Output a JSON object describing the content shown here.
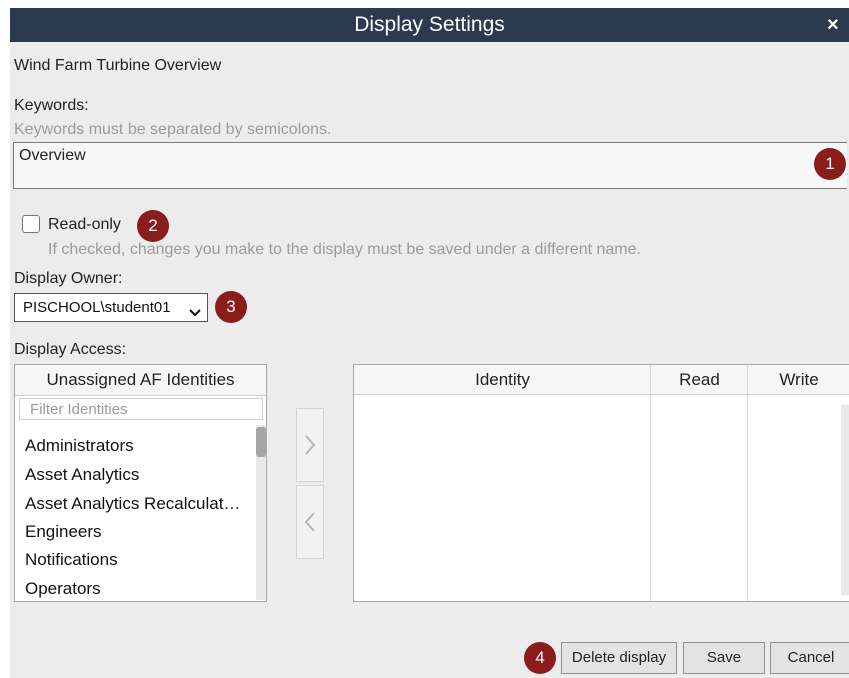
{
  "dialog": {
    "title": "Display Settings",
    "close_glyph": "×",
    "display_name": "Wind Farm Turbine Overview"
  },
  "keywords": {
    "label": "Keywords:",
    "hint": "Keywords must be separated by semicolons.",
    "value": "Overview"
  },
  "readonly": {
    "label": "Read-only",
    "checked": false,
    "hint": "If checked, changes you make to the display must be saved under a different name."
  },
  "owner": {
    "label": "Display Owner:",
    "selected": "PISCHOOL\\student01"
  },
  "access": {
    "label": "Display Access:",
    "unassigned_header": "Unassigned AF Identities",
    "filter_placeholder": "Filter Identities",
    "identities": [
      "Administrators",
      "Asset Analytics",
      "Asset Analytics Recalculat…",
      "Engineers",
      "Notifications",
      "Operators"
    ],
    "columns": [
      "Identity",
      "Read",
      "Write"
    ],
    "add_icon": "chevron-right-icon",
    "remove_icon": "chevron-left-icon"
  },
  "buttons": {
    "delete": "Delete display",
    "save": "Save",
    "cancel": "Cancel"
  },
  "callouts": [
    "1",
    "2",
    "3",
    "4"
  ],
  "colors": {
    "titlebar": "#2b3a4f",
    "badge": "#8b1c1c",
    "background": "#ececec"
  }
}
